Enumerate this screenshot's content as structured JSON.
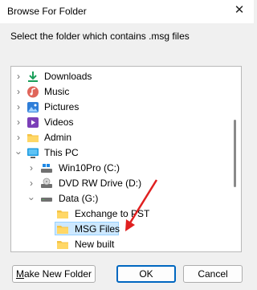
{
  "dialog": {
    "title": "Browse For Folder",
    "close_glyph": "✕",
    "prompt": "Select the folder which contains .msg files"
  },
  "tree": {
    "items": [
      {
        "label": "Downloads",
        "icon": "download-icon"
      },
      {
        "label": "Music",
        "icon": "music-icon"
      },
      {
        "label": "Pictures",
        "icon": "pictures-icon"
      },
      {
        "label": "Videos",
        "icon": "videos-icon"
      },
      {
        "label": "Admin",
        "icon": "folder-icon"
      },
      {
        "label": "This PC",
        "icon": "monitor-icon",
        "expanded": true
      },
      {
        "label": "Win10Pro (C:)",
        "icon": "drive-icon"
      },
      {
        "label": "DVD RW Drive (D:)",
        "icon": "dvd-drive-icon"
      },
      {
        "label": "Data (G:)",
        "icon": "drive-icon",
        "expanded": true
      },
      {
        "label": "Exchange to PST",
        "icon": "folder-icon"
      },
      {
        "label": "MSG Files",
        "icon": "folder-icon",
        "selected": true
      },
      {
        "label": "New built",
        "icon": "folder-icon"
      }
    ]
  },
  "buttons": {
    "new_folder_mnemonic": "M",
    "new_folder_rest": "ake New Folder",
    "ok": "OK",
    "cancel": "Cancel"
  },
  "colors": {
    "selection": "#cce8ff",
    "primary_border": "#0067c0",
    "folder": "#f4c345",
    "annotation_arrow": "#e02020"
  }
}
